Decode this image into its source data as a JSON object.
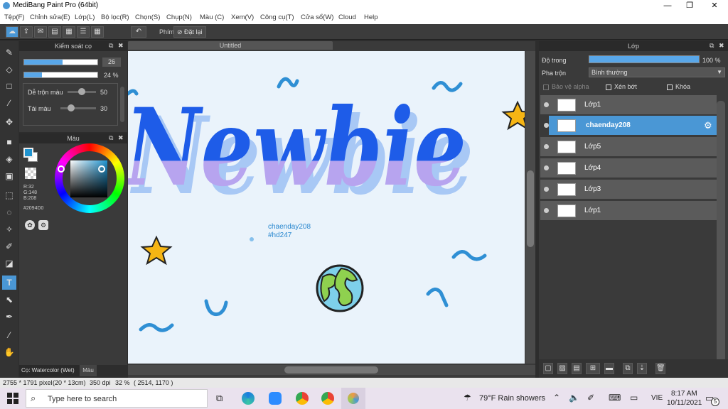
{
  "window": {
    "title": "MediBang Paint Pro (64bit)",
    "min": "—",
    "max": "❐",
    "close": "✕"
  },
  "menu": [
    "Tệp(F)",
    "Chỉnh sửa(E)",
    "Lớp(L)",
    "Bộ lọc(R)",
    "Chọn(S)",
    "Chụp(N)",
    "Màu (C)",
    "Xem(V)",
    "Công cụ(T)",
    "Cửa sổ(W)",
    "Cloud",
    "Help"
  ],
  "toolbar": {
    "key_label": "Phím",
    "reset_label": "Đặt lại"
  },
  "brush_panel": {
    "title": "Kiểm soát cọ",
    "size": "26",
    "opacity": "24 %",
    "size_fraction": 0.52,
    "opacity_fraction": 0.24,
    "blend_label": "Dễ trộn màu",
    "blend_value": "50",
    "blend_fraction": 0.5,
    "resample_label": "Tái màu",
    "resample_value": "30",
    "resample_fraction": 0.3
  },
  "color_panel": {
    "title": "Màu",
    "r": "R:32",
    "g": "G:148",
    "b": "B:208",
    "hex": "#2094D0",
    "color": "#2094D0"
  },
  "bottom_tabs": {
    "brush_tab": "Cọ: Watercolor (Wet)",
    "color_tab": "Màu"
  },
  "canvas": {
    "tab": "Untitled",
    "artwork_text": "Newbie",
    "credit_line1": "chaenday208",
    "credit_line2": "#hd247"
  },
  "layer_panel": {
    "title": "Lớp",
    "opacity_label": "Độ trong",
    "opacity_value": "100 %",
    "opacity_fraction": 1.0,
    "blend_label": "Pha trộn",
    "blend_value": "Bình thường",
    "protect_alpha": "Bảo vệ alpha",
    "clip": "Xén bớt",
    "lock": "Khóa",
    "layers": [
      {
        "name": "Lớp1",
        "selected": false
      },
      {
        "name": "chaenday208",
        "selected": true
      },
      {
        "name": "Lớp5",
        "selected": false
      },
      {
        "name": "Lớp4",
        "selected": false
      },
      {
        "name": "Lớp3",
        "selected": false
      },
      {
        "name": "Lớp1",
        "selected": false
      }
    ]
  },
  "status": {
    "size": "2755 * 1791 pixel",
    "cm": "(20 * 13cm)",
    "dpi": "350 dpi",
    "zoom": "32 %",
    "coords": "( 2514, 1170 )"
  },
  "taskbar": {
    "search_placeholder": "Type here to search",
    "weather": "79°F  Rain showers",
    "lang": "VIE",
    "time": "8:17 AM",
    "date": "10/11/2021",
    "notif": "5"
  },
  "colors": {
    "accent": "#4a97d5",
    "panel": "#3a3a3a",
    "dark": "#2a2a2a"
  }
}
